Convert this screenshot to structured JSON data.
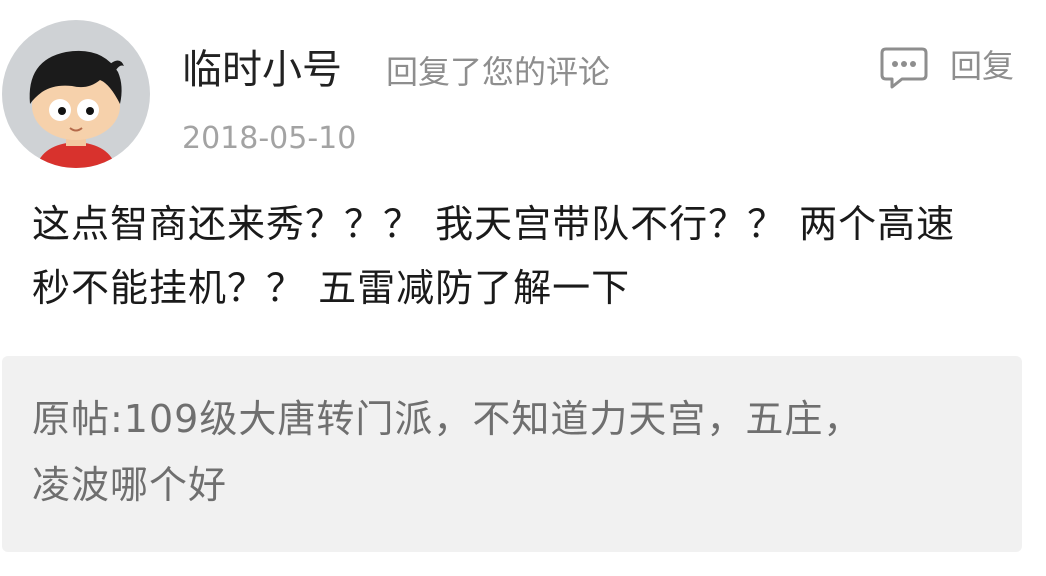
{
  "comment": {
    "avatar_icon": "cartoon-boy-avatar-icon",
    "username": "临时小号",
    "action_text": "回复了您的评论",
    "date": "2018-05-10",
    "reply_icon": "speech-bubble-icon",
    "reply_label": "回复",
    "body_line1": "这点智商还来秀？？？ 我天宫带队不行？？ 两个高速",
    "body_line2": "秒不能挂机？？ 五雷减防了解一下"
  },
  "quoted_post": {
    "line1": "原帖:109级大唐转门派，不知道力天宫，五庄，",
    "line2": "凌波哪个好"
  },
  "colors": {
    "username": "#222222",
    "secondary_text": "#8e8e8e",
    "date": "#a3a3a3",
    "quote_background": "#f1f1f1",
    "quote_text": "#6f6f6f"
  }
}
